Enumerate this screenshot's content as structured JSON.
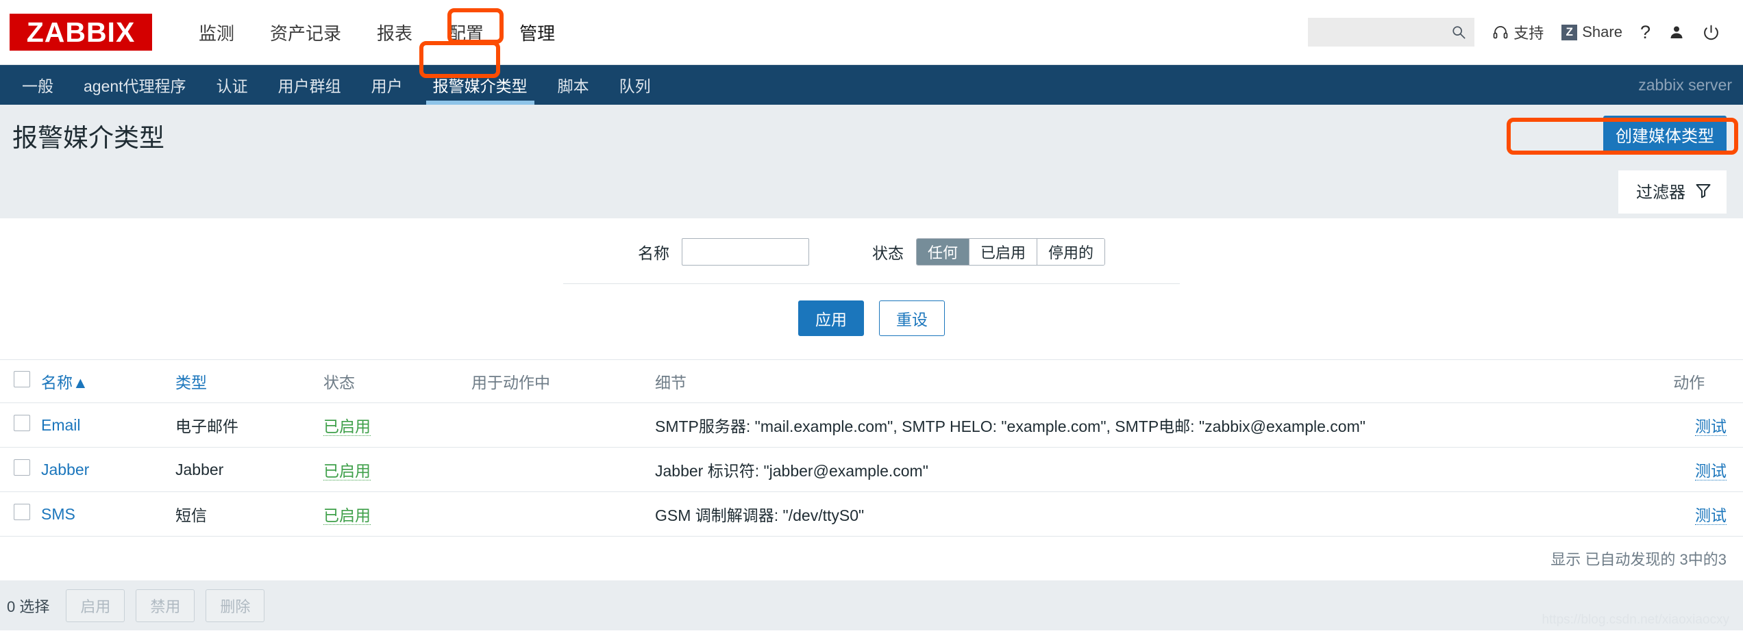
{
  "brand": {
    "logo_text": "ZABBIX",
    "logo_color": "#d40000"
  },
  "mainnav": {
    "items": [
      {
        "label": "监测",
        "active": false
      },
      {
        "label": "资产记录",
        "active": false
      },
      {
        "label": "报表",
        "active": false
      },
      {
        "label": "配置",
        "active": false
      },
      {
        "label": "管理",
        "active": true
      }
    ]
  },
  "header_right": {
    "search_value": "",
    "search_placeholder": "",
    "support_label": "支持",
    "share_badge": "Z",
    "share_label": "Share",
    "help_label": "?"
  },
  "subnav": {
    "items": [
      {
        "label": "一般",
        "active": false
      },
      {
        "label": "agent代理程序",
        "active": false
      },
      {
        "label": "认证",
        "active": false
      },
      {
        "label": "用户群组",
        "active": false
      },
      {
        "label": "用户",
        "active": false
      },
      {
        "label": "报警媒介类型",
        "active": true
      },
      {
        "label": "脚本",
        "active": false
      },
      {
        "label": "队列",
        "active": false
      }
    ],
    "server": "zabbix server"
  },
  "page": {
    "title": "报警媒介类型",
    "create_button": "创建媒体类型",
    "filter_tab": "过滤器"
  },
  "filter": {
    "name_label": "名称",
    "name_value": "",
    "status_label": "状态",
    "status_options": [
      {
        "label": "任何",
        "selected": true
      },
      {
        "label": "已启用",
        "selected": false
      },
      {
        "label": "停用的",
        "selected": false
      }
    ],
    "apply_label": "应用",
    "reset_label": "重设"
  },
  "table": {
    "columns": {
      "name": "名称",
      "sort_arrow": "▲",
      "type": "类型",
      "status": "状态",
      "used_in_actions": "用于动作中",
      "details": "细节",
      "actions": "动作"
    },
    "rows": [
      {
        "name": "Email",
        "type": "电子邮件",
        "status": "已启用",
        "used_in_actions": "",
        "details": "SMTP服务器: \"mail.example.com\", SMTP HELO: \"example.com\", SMTP电邮: \"zabbix@example.com\"",
        "action": "测试"
      },
      {
        "name": "Jabber",
        "type": "Jabber",
        "status": "已启用",
        "used_in_actions": "",
        "details": "Jabber 标识符: \"jabber@example.com\"",
        "action": "测试"
      },
      {
        "name": "SMS",
        "type": "短信",
        "status": "已启用",
        "used_in_actions": "",
        "details": "GSM 调制解调器: \"/dev/ttyS0\"",
        "action": "测试"
      }
    ],
    "footer": "显示 已自动发现的 3中的3"
  },
  "bottom": {
    "selection": "0 选择",
    "enable_label": "启用",
    "disable_label": "禁用",
    "delete_label": "删除"
  },
  "watermark": "https://blog.csdn.net/xiaoxiaocxy",
  "colors": {
    "accent_blue": "#1b76bc",
    "nav_dark": "#17456b",
    "annotation_red": "#fc4c02",
    "enabled_green": "#3fa04a",
    "page_bg": "#e9edf0"
  }
}
